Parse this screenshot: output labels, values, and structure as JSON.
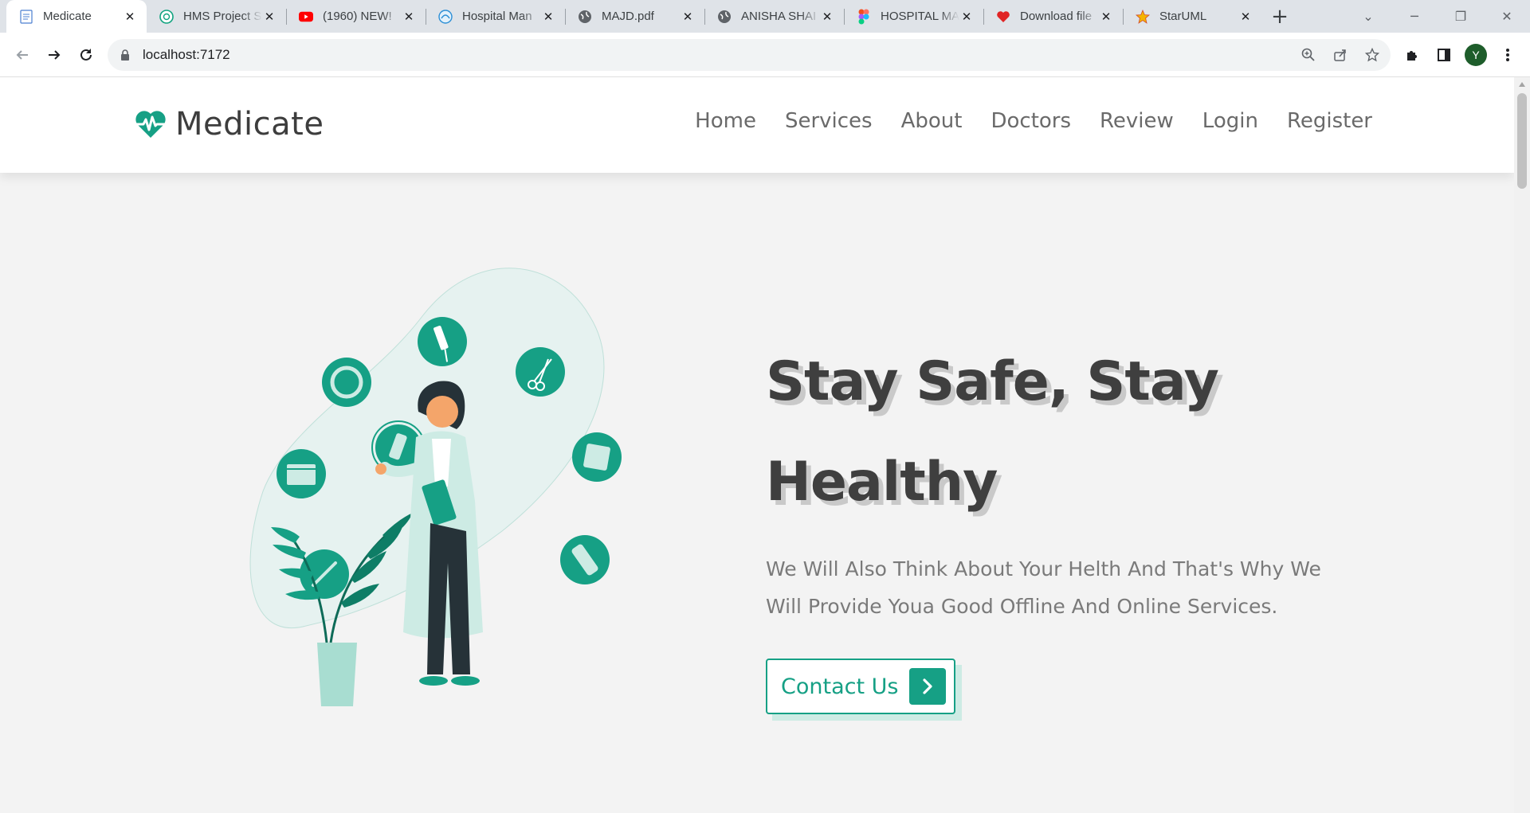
{
  "browser": {
    "tabs": [
      {
        "title": "Medicate",
        "icon": "page-icon",
        "active": true
      },
      {
        "title": "HMS Project S",
        "icon": "chatgpt-icon"
      },
      {
        "title": "(1960) NEW!",
        "icon": "youtube-icon"
      },
      {
        "title": "Hospital Man",
        "icon": "cloud-icon"
      },
      {
        "title": "MAJD.pdf",
        "icon": "globe-icon"
      },
      {
        "title": "ANISHA SHAI",
        "icon": "globe-icon"
      },
      {
        "title": "HOSPITAL MA",
        "icon": "figma-icon"
      },
      {
        "title": "Download file",
        "icon": "heart-icon"
      },
      {
        "title": "StarUML",
        "icon": "star-icon"
      }
    ],
    "url": "localhost:7172",
    "profile_initial": "Y"
  },
  "site": {
    "brand": "Medicate",
    "nav": [
      "Home",
      "Services",
      "About",
      "Doctors",
      "Review",
      "Login",
      "Register"
    ],
    "hero": {
      "title_line1": "Stay Safe, Stay",
      "title_line2": "Healthy",
      "subtitle": "We Will Also Think About Your Helth And That's Why We Will Provide Youa Good Offline And Online Services.",
      "cta_label": "Contact Us"
    },
    "colors": {
      "accent": "#16a085",
      "heading": "#3f3f3f",
      "text": "#7a7a7a",
      "background": "#f3f3f3"
    }
  }
}
